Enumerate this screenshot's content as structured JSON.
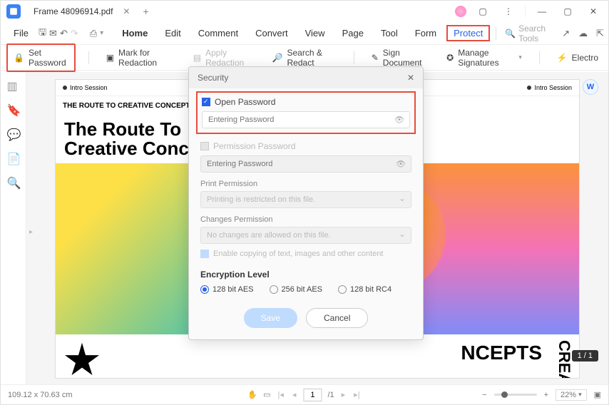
{
  "titlebar": {
    "filename": "Frame 48096914.pdf"
  },
  "menu": {
    "file": "File",
    "home": "Home",
    "edit": "Edit",
    "comment": "Comment",
    "convert": "Convert",
    "view": "View",
    "page": "Page",
    "tool": "Tool",
    "form": "Form",
    "protect": "Protect",
    "search_placeholder": "Search Tools"
  },
  "toolbar": {
    "set_password": "Set Password",
    "mark_redaction": "Mark for Redaction",
    "apply_redaction": "Apply Redaction",
    "search_redact": "Search & Redact",
    "sign_document": "Sign Document",
    "manage_signatures": "Manage Signatures",
    "electro": "Electro"
  },
  "document": {
    "session_label": "Intro Session",
    "banner": "THE ROUTE TO CREATIVE CONCEPTS THE ROUTE TO CREATIVE CONCEPTS THE R",
    "title_line1": "The Route To",
    "title_line2": "Creative Concepts",
    "ncepts": "NCEPTS",
    "creative_vert": "CREATIVE"
  },
  "dialog": {
    "title": "Security",
    "open_password_label": "Open Password",
    "password_placeholder": "Entering Password",
    "permission_password_label": "Permission Password",
    "print_permission_label": "Print Permission",
    "print_permission_value": "Printing is restricted on this file.",
    "changes_permission_label": "Changes Permission",
    "changes_permission_value": "No changes are allowed on this file.",
    "enable_copy": "Enable copying of text, images and other content",
    "encryption_title": "Encryption Level",
    "enc_128aes": "128 bit AES",
    "enc_256aes": "256 bit AES",
    "enc_128rc4": "128 bit RC4",
    "save": "Save",
    "cancel": "Cancel"
  },
  "status": {
    "dimensions": "109.12 x 70.63 cm",
    "page_current": "1",
    "page_total": "/1",
    "zoom": "22%",
    "page_counter": "1 / 1"
  }
}
